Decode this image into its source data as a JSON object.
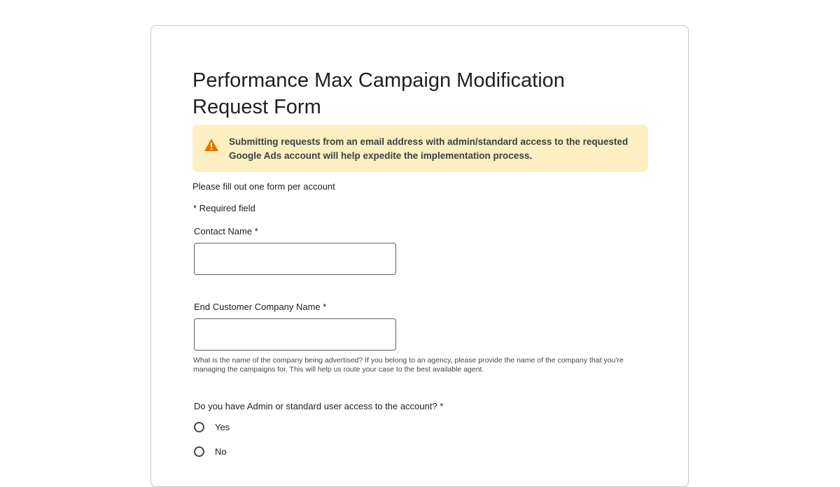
{
  "form": {
    "title": "Performance Max Campaign Modification Request Form",
    "banner": {
      "icon": "warning-icon",
      "icon_color": "#e37400",
      "background": "#feefc3",
      "text": "Submitting requests from an email address with admin/standard access to the requested Google Ads account will help expedite the implementation process."
    },
    "intro": "Please fill out one form per account",
    "required_note": "* Required field",
    "fields": {
      "contact_name": {
        "label": "Contact Name *",
        "value": ""
      },
      "company_name": {
        "label": "End Customer Company Name *",
        "value": "",
        "help": "What is the name of the company being advertised? If you belong to an agency, please provide the name of the company that you're managing the campaigns for. This will help us route your case to the best available agent."
      },
      "access": {
        "label": "Do you have Admin or standard user access to the account? *",
        "options": [
          "Yes",
          "No"
        ],
        "selected": null
      }
    }
  }
}
